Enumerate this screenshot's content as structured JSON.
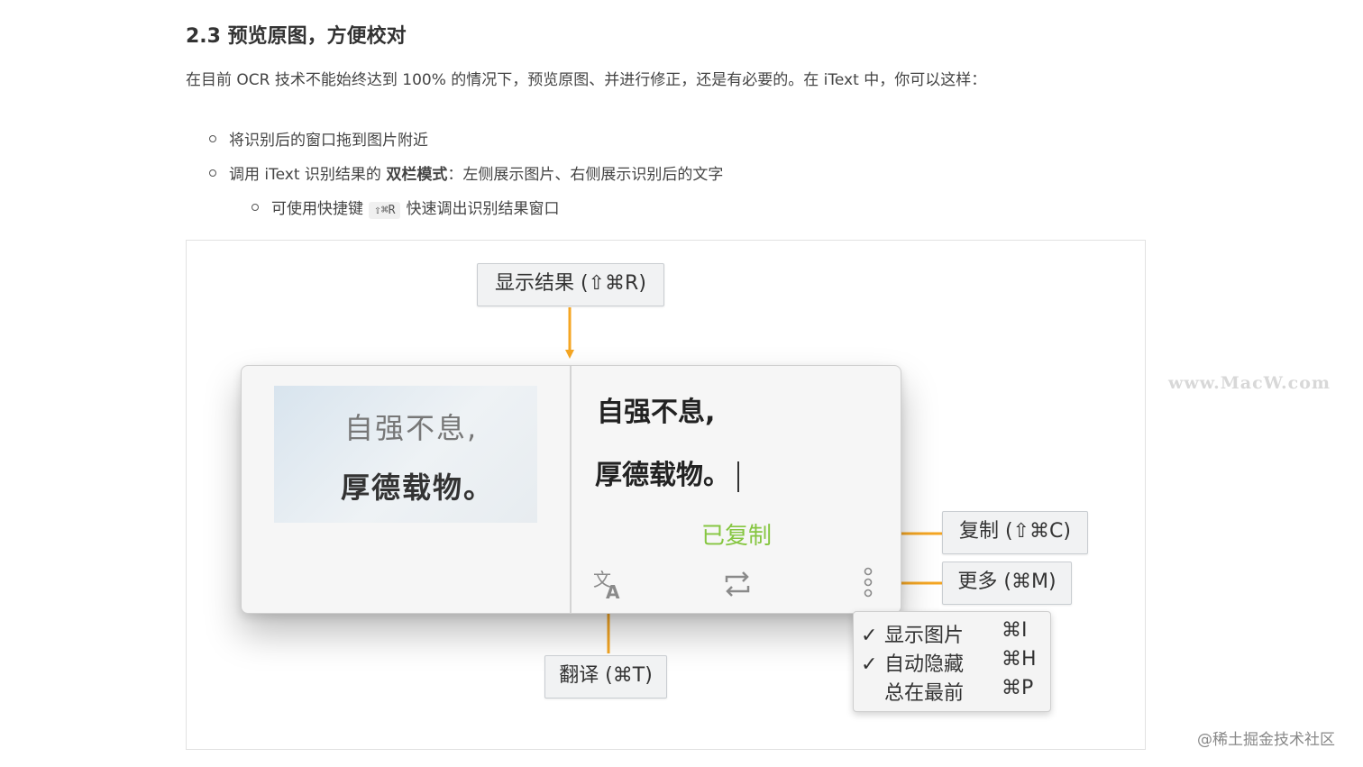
{
  "heading": "2.3 预览原图，方便校对",
  "paragraph": "在目前 OCR 技术不能始终达到 100% 的情况下，预览原图、并进行修正，还是有必要的。在 iText 中，你可以这样：",
  "bullets": {
    "item1": "将识别后的窗口拖到图片附近",
    "item2_prefix": "调用 iText 识别结果的 ",
    "item2_bold": "双栏模式",
    "item2_suffix": "：左侧展示图片、右侧展示识别后的文字",
    "sub_prefix": "可使用快捷键",
    "sub_kbd": "⇧⌘R",
    "sub_suffix": "快速调出识别结果窗口"
  },
  "figure": {
    "callout_show": "显示结果 (⇧⌘R)",
    "callout_copy": "复制 (⇧⌘C)",
    "callout_more": "更多 (⌘M)",
    "callout_translate": "翻译 (⌘T)",
    "source_line1": "自强不息,",
    "source_line2": "厚德载物。",
    "ocr_line1": "自强不息,",
    "ocr_line2": "厚德载物。",
    "copied_label": "已复制",
    "menu": [
      {
        "checked": true,
        "check": "✓",
        "label": "显示图片",
        "shortcut": "⌘I"
      },
      {
        "checked": true,
        "check": "✓",
        "label": "自动隐藏",
        "shortcut": "⌘H"
      },
      {
        "checked": false,
        "check": "",
        "label": "总在最前",
        "shortcut": "⌘P"
      }
    ],
    "icons": [
      "translate-icon",
      "repeat-icon",
      "more-vertical-icon"
    ],
    "colors": {
      "arrow": "#f5a623",
      "copied": "#86c641"
    }
  },
  "watermarks": {
    "top": "www.MacW.com",
    "bottom": "@稀土掘金技术社区"
  }
}
